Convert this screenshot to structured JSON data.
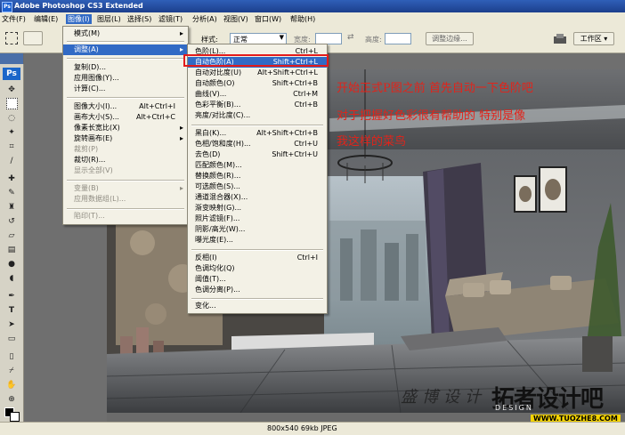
{
  "app": {
    "title": "Adobe Photoshop CS3 Extended",
    "icon": "ps-mini-icon"
  },
  "menubar": {
    "items": [
      "文件(F)",
      "编辑(E)",
      "图像(I)",
      "图层(L)",
      "选择(S)",
      "滤镜(T)",
      "分析(A)",
      "视图(V)",
      "窗口(W)",
      "帮助(H)"
    ],
    "active_index": 2
  },
  "options": {
    "style_label": "样式:",
    "style_value": "正常",
    "width_label": "宽度:",
    "height_label": "高度:",
    "refine_edge_label": "调整边缘...",
    "workspace_label": "工作区 ▾"
  },
  "toolbox": {
    "logo": "Ps"
  },
  "image_menu": {
    "rows": [
      {
        "label": "模式(M)",
        "shortcut": "",
        "arrow": "▸",
        "state": "normal"
      },
      {
        "label": "调整(A)",
        "shortcut": "",
        "arrow": "▸",
        "state": "highlighted"
      },
      {
        "label": "复制(D)...",
        "shortcut": "",
        "arrow": "",
        "state": "normal"
      },
      {
        "label": "应用图像(Y)...",
        "shortcut": "",
        "arrow": "",
        "state": "normal"
      },
      {
        "label": "计算(C)...",
        "shortcut": "",
        "arrow": "",
        "state": "normal"
      },
      {
        "label": "图像大小(I)...",
        "shortcut": "Alt+Ctrl+I",
        "arrow": "",
        "state": "normal"
      },
      {
        "label": "画布大小(S)...",
        "shortcut": "Alt+Ctrl+C",
        "arrow": "",
        "state": "normal"
      },
      {
        "label": "像素长宽比(X)",
        "shortcut": "",
        "arrow": "▸",
        "state": "normal"
      },
      {
        "label": "旋转画布(E)",
        "shortcut": "",
        "arrow": "▸",
        "state": "normal"
      },
      {
        "label": "裁剪(P)",
        "shortcut": "",
        "arrow": "",
        "state": "disabled"
      },
      {
        "label": "裁切(R)...",
        "shortcut": "",
        "arrow": "",
        "state": "normal"
      },
      {
        "label": "显示全部(V)",
        "shortcut": "",
        "arrow": "",
        "state": "disabled"
      },
      {
        "label": "变量(B)",
        "shortcut": "",
        "arrow": "▸",
        "state": "disabled"
      },
      {
        "label": "应用数据组(L)...",
        "shortcut": "",
        "arrow": "",
        "state": "disabled"
      },
      {
        "label": "陷印(T)...",
        "shortcut": "",
        "arrow": "",
        "state": "disabled"
      }
    ]
  },
  "adjust_submenu": {
    "rows": [
      {
        "label": "色阶(L)...",
        "shortcut": "Ctrl+L",
        "state": "normal"
      },
      {
        "label": "自动色阶(A)",
        "shortcut": "Shift+Ctrl+L",
        "state": "highlighted"
      },
      {
        "label": "自动对比度(U)",
        "shortcut": "Alt+Shift+Ctrl+L",
        "state": "normal"
      },
      {
        "label": "自动颜色(O)",
        "shortcut": "Shift+Ctrl+B",
        "state": "normal"
      },
      {
        "label": "曲线(V)...",
        "shortcut": "Ctrl+M",
        "state": "normal"
      },
      {
        "label": "色彩平衡(B)...",
        "shortcut": "Ctrl+B",
        "state": "normal"
      },
      {
        "label": "亮度/对比度(C)...",
        "shortcut": "",
        "state": "normal"
      },
      {
        "label": "黑白(K)...",
        "shortcut": "Alt+Shift+Ctrl+B",
        "state": "normal"
      },
      {
        "label": "色相/饱和度(H)...",
        "shortcut": "Ctrl+U",
        "state": "normal"
      },
      {
        "label": "去色(D)",
        "shortcut": "Shift+Ctrl+U",
        "state": "normal"
      },
      {
        "label": "匹配颜色(M)...",
        "shortcut": "",
        "state": "normal"
      },
      {
        "label": "替换颜色(R)...",
        "shortcut": "",
        "state": "normal"
      },
      {
        "label": "可选颜色(S)...",
        "shortcut": "",
        "state": "normal"
      },
      {
        "label": "通道混合器(X)...",
        "shortcut": "",
        "state": "normal"
      },
      {
        "label": "渐变映射(G)...",
        "shortcut": "",
        "state": "normal"
      },
      {
        "label": "照片滤镜(F)...",
        "shortcut": "",
        "state": "normal"
      },
      {
        "label": "阴影/高光(W)...",
        "shortcut": "",
        "state": "normal"
      },
      {
        "label": "曝光度(E)...",
        "shortcut": "",
        "state": "normal"
      },
      {
        "label": "反相(I)",
        "shortcut": "Ctrl+I",
        "state": "normal"
      },
      {
        "label": "色调均化(Q)",
        "shortcut": "",
        "state": "normal"
      },
      {
        "label": "阈值(T)...",
        "shortcut": "",
        "state": "normal"
      },
      {
        "label": "色调分离(P)...",
        "shortcut": "",
        "state": "normal"
      },
      {
        "label": "变化...",
        "shortcut": "",
        "state": "normal"
      }
    ]
  },
  "annotation": {
    "line1": "开始正式P图之前 首先自动一下色阶吧",
    "line2": "对于把握好色彩很有帮助的 特别是像",
    "line3": "我这样的菜鸟"
  },
  "watermark": {
    "studio": "盛博设计",
    "site_logo": "拓者设计吧",
    "site_sub": "DESIGN",
    "site_url": "WWW.TUOZHE8.COM"
  },
  "status": {
    "text": "800x540  69kb  JPEG"
  },
  "colors": {
    "annotation": "#e2231a",
    "highlight": "#316ac5",
    "highlight_box": "#e31b1b"
  }
}
